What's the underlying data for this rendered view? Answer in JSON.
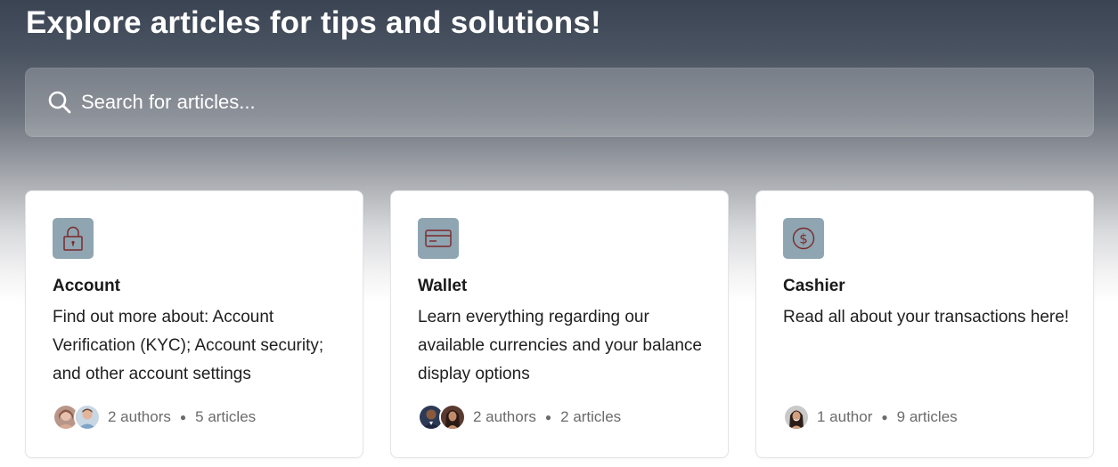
{
  "header": {
    "title": "Explore articles for tips and solutions!"
  },
  "search": {
    "placeholder": "Search for articles...",
    "icon": "search-icon"
  },
  "colors": {
    "icon_tile": "#8fa5b2",
    "icon_stroke": "#7a2a2a",
    "heading_text": "#ffffff"
  },
  "collections": [
    {
      "icon": "lock-icon",
      "title": "Account",
      "description": "Find out more about: Account Verification (KYC); Account security; and other account settings",
      "authors": "2 authors",
      "articles": "5 articles"
    },
    {
      "icon": "credit-card-icon",
      "title": "Wallet",
      "description": "Learn everything regarding our available currencies and your balance display options",
      "authors": "2 authors",
      "articles": "2 articles"
    },
    {
      "icon": "dollar-coin-icon",
      "title": "Cashier",
      "description": "Read all about your transactions here!",
      "authors": "1 author",
      "articles": "9 articles"
    }
  ]
}
